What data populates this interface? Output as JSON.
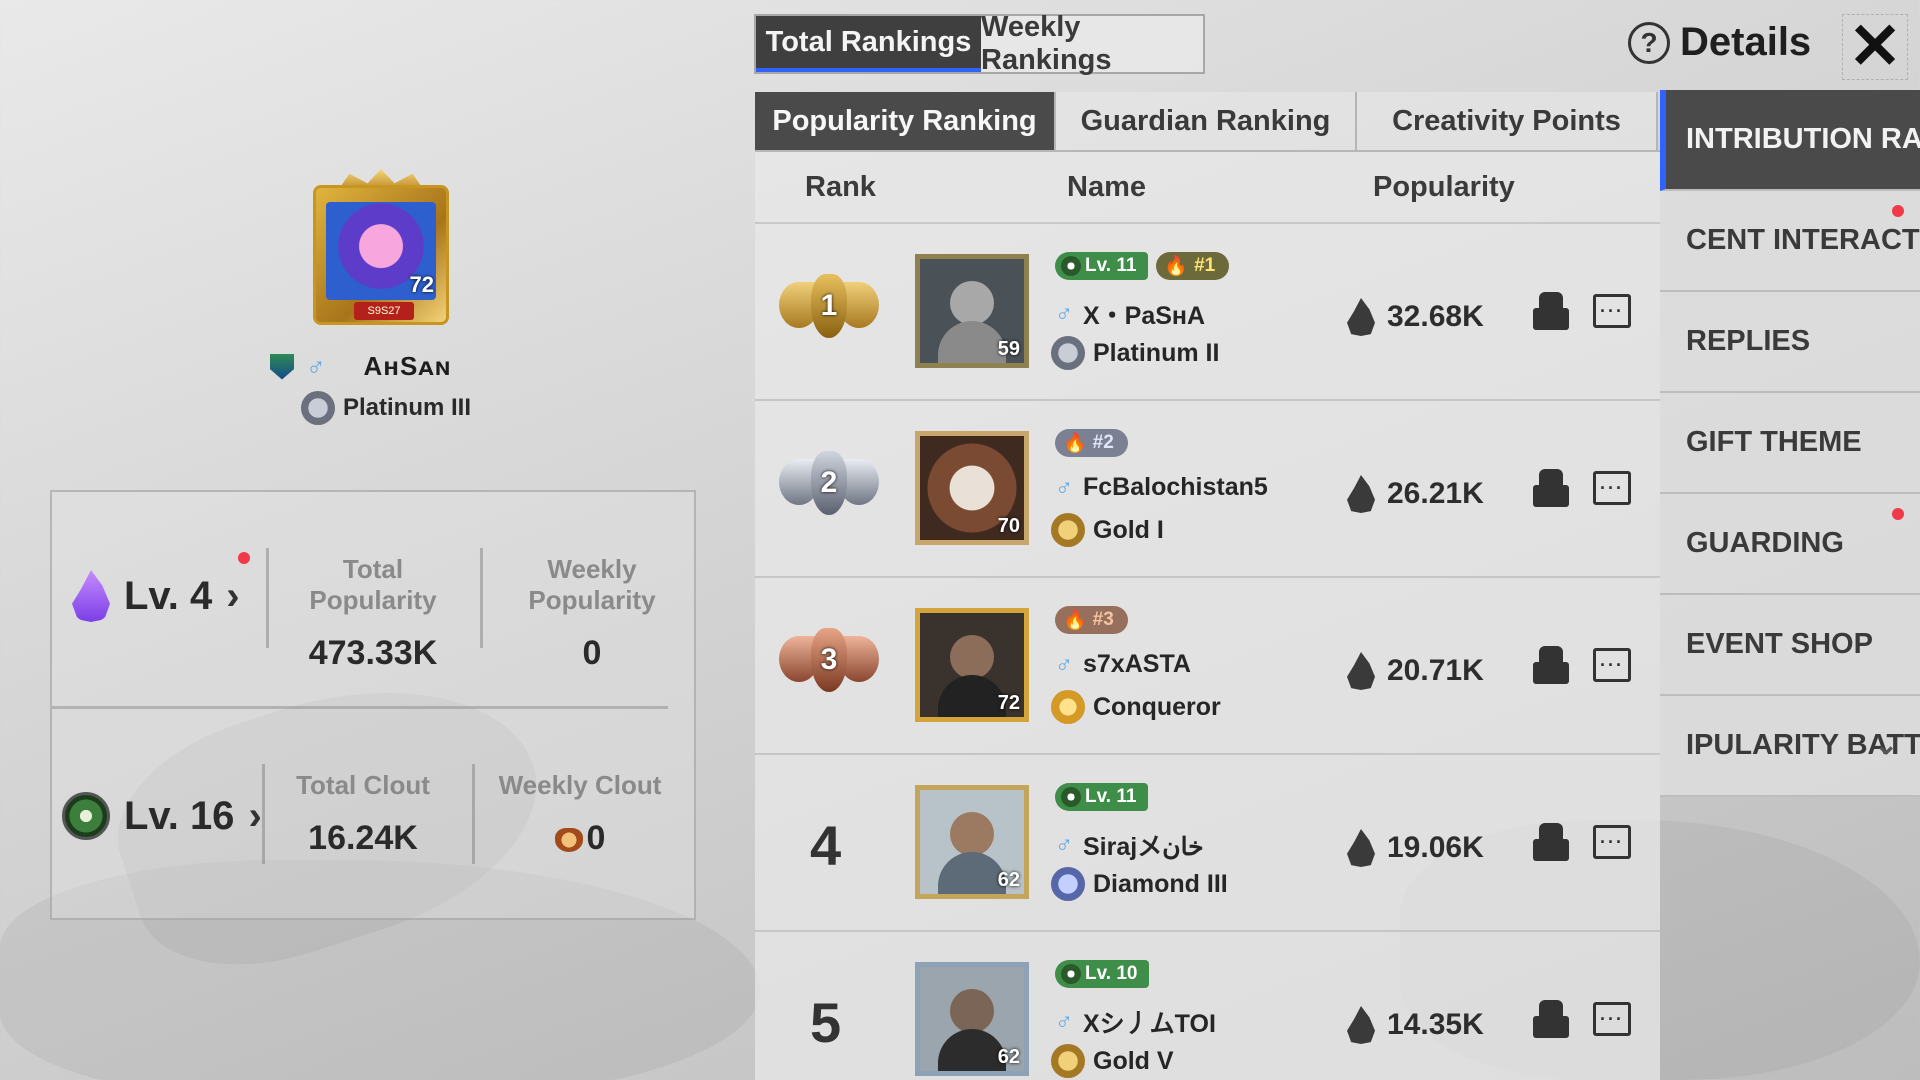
{
  "profile": {
    "avatar_level": "72",
    "avatar_tag": "S9S27",
    "name": "AʜSᴀɴ",
    "tier": "Platinum III"
  },
  "stats": {
    "popularity_level": "Lv. 4",
    "total_popularity_label": "Total Popularity",
    "total_popularity": "473.33K",
    "weekly_popularity_label": "Weekly Popularity",
    "weekly_popularity": "0",
    "clout_level": "Lv. 16",
    "total_clout_label": "Total Clout",
    "total_clout": "16.24K",
    "weekly_clout_label": "Weekly Clout",
    "weekly_clout": "0"
  },
  "top_tabs": {
    "total": "Total Rankings",
    "weekly": "Weekly Rankings"
  },
  "details_label": "Details",
  "sub_tabs": {
    "popularity": "Popularity Ranking",
    "guardian": "Guardian Ranking",
    "creativity": "Creativity Points"
  },
  "table": {
    "headers": {
      "rank": "Rank",
      "name": "Name",
      "popularity": "Popularity"
    },
    "rows": [
      {
        "rank": "1",
        "avatar_level": "59",
        "lv": "Lv. 11",
        "tag": "#1",
        "name": "X・PaSʜA",
        "tier": "Platinum II",
        "popularity": "32.68K"
      },
      {
        "rank": "2",
        "avatar_level": "70",
        "lv": "",
        "tag": "#2",
        "name": "FcBalochistan5",
        "tier": "Gold I",
        "popularity": "26.21K"
      },
      {
        "rank": "3",
        "avatar_level": "72",
        "lv": "",
        "tag": "#3",
        "name": "s7xASTA",
        "tier": "Conqueror",
        "popularity": "20.71K"
      },
      {
        "rank": "4",
        "avatar_level": "62",
        "lv": "Lv. 11",
        "tag": "",
        "name": "Sirajメخان",
        "tier": "Diamond III",
        "popularity": "19.06K"
      },
      {
        "rank": "5",
        "avatar_level": "62",
        "lv": "Lv. 10",
        "tag": "",
        "name": "Xシ丿ムTOI",
        "tier": "Gold V",
        "popularity": "14.35K"
      }
    ]
  },
  "side_menu": {
    "items": [
      {
        "label": "INTRIBUTION RANKIN"
      },
      {
        "label": "CENT INTERACTIONS"
      },
      {
        "label": "REPLIES"
      },
      {
        "label": "GIFT THEME"
      },
      {
        "label": "GUARDING"
      },
      {
        "label": "EVENT SHOP"
      },
      {
        "label": "IPULARITY BATT"
      }
    ]
  },
  "colors": {
    "accent": "#2f62ff",
    "notification": "#f03a4a",
    "level_badge": "#3e8d49"
  }
}
